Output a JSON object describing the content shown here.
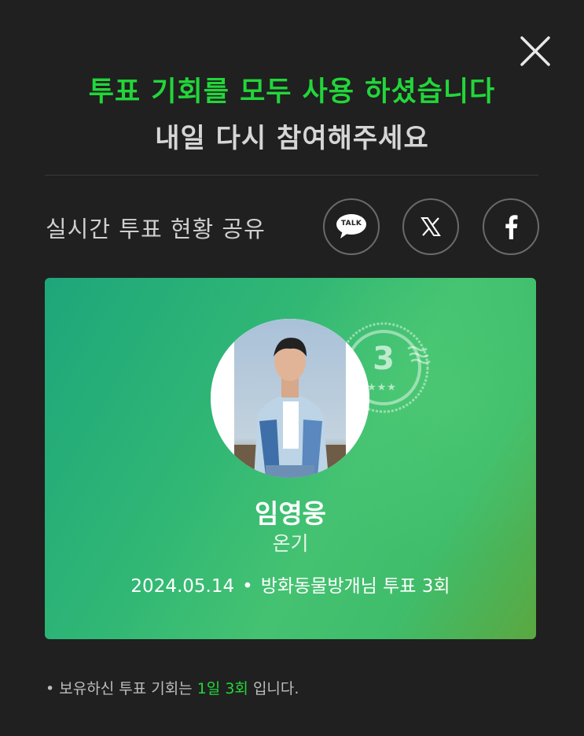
{
  "colors": {
    "accent_green": "#22d63a",
    "background": "#202020",
    "card_gradient_start": "#1ea67b",
    "card_gradient_end": "#5aa840"
  },
  "header": {
    "close_icon": "close-icon",
    "headline": "투표 기회를 모두 사용 하셨습니다",
    "subline": "내일 다시 참여해주세요"
  },
  "share": {
    "label": "실시간 투표 현황 공유",
    "buttons": [
      {
        "icon": "kakaotalk-icon",
        "text": "TALK"
      },
      {
        "icon": "x-icon"
      },
      {
        "icon": "facebook-icon"
      }
    ]
  },
  "card": {
    "rank_stamp": "3",
    "rank_stars": "★★★",
    "artist_name": "임영웅",
    "song_title": "온기",
    "date": "2024.05.14",
    "separator": "•",
    "vote_text": "방화동물방개님 투표 3회"
  },
  "footer": {
    "bullet": "•",
    "text_before": "보유하신 투표 기회는",
    "highlight": "1일 3회",
    "text_after": "입니다."
  }
}
